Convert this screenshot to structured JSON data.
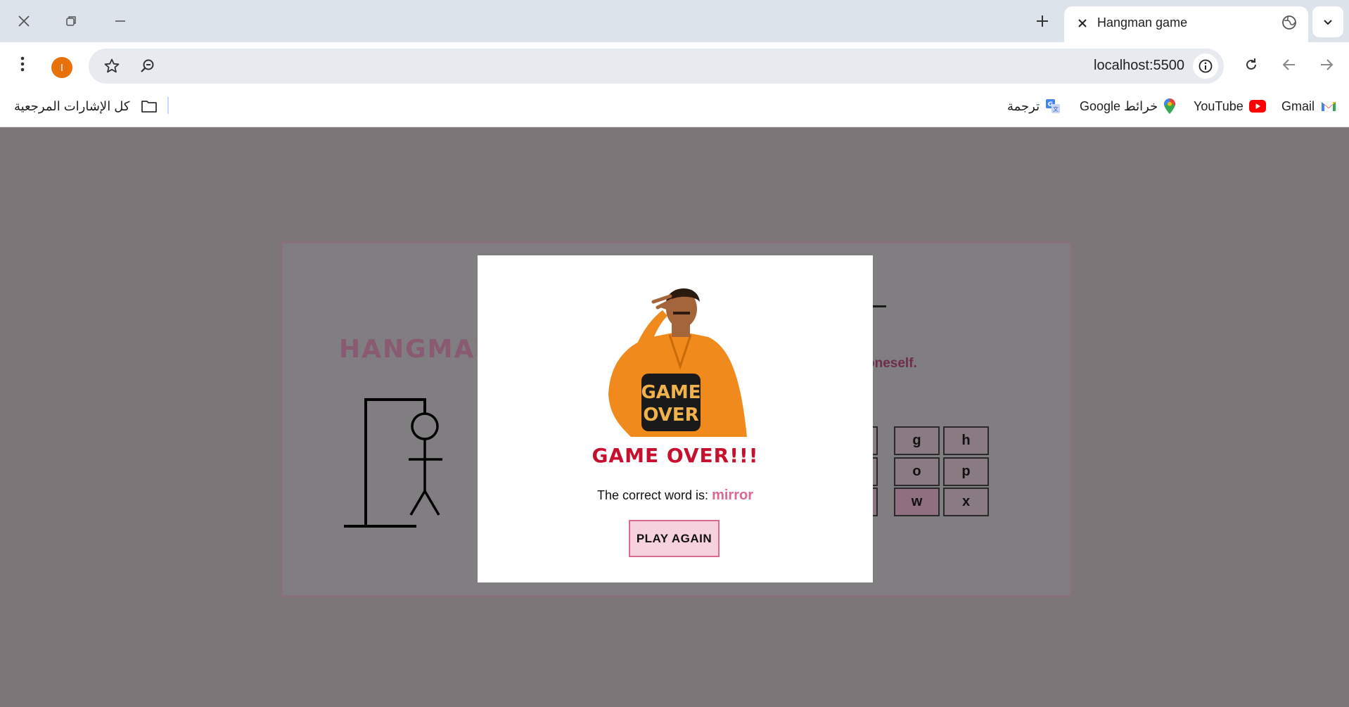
{
  "browser": {
    "tab_title": "Hangman game",
    "profile_initial": "I",
    "url": "localhost:5500",
    "bookmarks": [
      {
        "label": "Gmail",
        "icon": "gmail-icon"
      },
      {
        "label": "YouTube",
        "icon": "youtube-icon"
      },
      {
        "label": "Google خرائط",
        "icon": "maps-icon"
      },
      {
        "label": "ترجمة",
        "icon": "translate-icon"
      }
    ],
    "all_bookmarks_label": "كل الإشارات المرجعية"
  },
  "game": {
    "title": "HANGMAN",
    "hint_fragment": "oneself.",
    "keys": [
      {
        "letter": "g"
      },
      {
        "letter": "h"
      },
      {
        "letter": "o"
      },
      {
        "letter": "p"
      },
      {
        "letter": "w"
      },
      {
        "letter": "x"
      }
    ]
  },
  "modal": {
    "image_caption_line1": "GAME",
    "image_caption_line2": "OVER",
    "title": "GAME OVER!!!",
    "message_prefix": "The correct word is:",
    "correct_word": "mirror",
    "play_again_label": "PLAY AGAIN"
  },
  "colors": {
    "overlay": "#7d7679",
    "game_title": "#8a5a72",
    "modal_title": "#c8102e",
    "word_highlight": "#d9698f",
    "button_bg": "#f6d2de",
    "button_border": "#d96b91",
    "profile_avatar": "#e8710a"
  }
}
